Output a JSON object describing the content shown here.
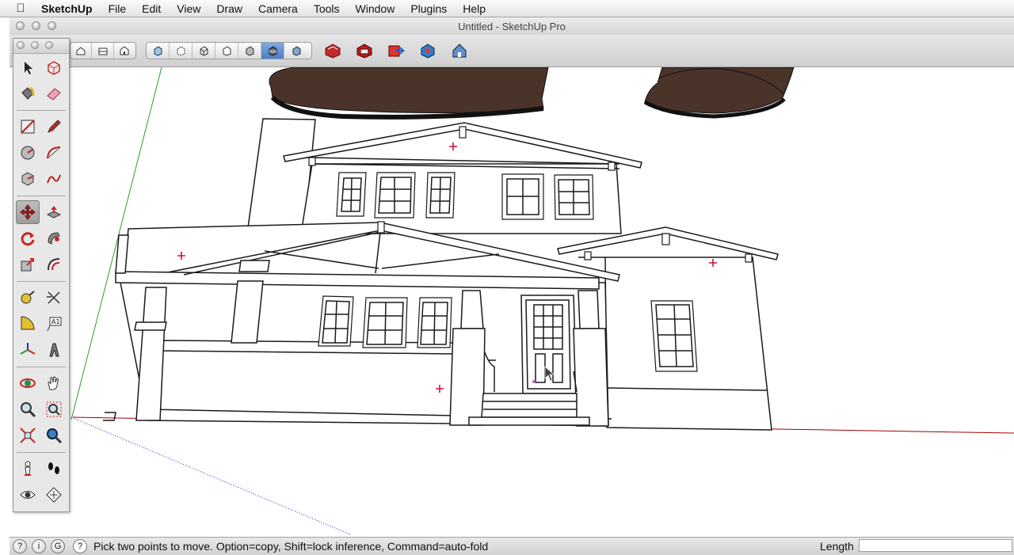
{
  "menubar": {
    "app_name": "SketchUp",
    "items": [
      "File",
      "Edit",
      "View",
      "Draw",
      "Camera",
      "Tools",
      "Window",
      "Plugins",
      "Help"
    ]
  },
  "window": {
    "title": "Untitled - SketchUp Pro"
  },
  "toolbar": {
    "view_buttons": [
      "iso-view",
      "top-view",
      "front-view",
      "right-view",
      "back-view",
      "left-view"
    ],
    "style_buttons": [
      "xray",
      "back-edges",
      "wireframe",
      "hidden-line",
      "shaded",
      "shaded-with-textures",
      "monochrome"
    ],
    "active_style": "shaded-with-textures",
    "warehouse_buttons": [
      "get-models",
      "share-model",
      "share-component",
      "extension-warehouse",
      "3d-warehouse"
    ]
  },
  "palette": {
    "tools": [
      "select",
      "make-component",
      "paint-bucket",
      "eraser",
      "rectangle",
      "line",
      "circle",
      "arc",
      "polygon",
      "freehand",
      "move",
      "push-pull",
      "rotate",
      "follow-me",
      "scale",
      "offset",
      "tape-measure",
      "dimension",
      "protractor",
      "text",
      "axes",
      "3d-text",
      "orbit",
      "pan",
      "zoom",
      "zoom-window",
      "zoom-extents",
      "previous",
      "position-camera",
      "walk",
      "look-around",
      "section-plane"
    ],
    "active_tool": "move"
  },
  "status": {
    "hint": "Pick two points to move.  Option=copy, Shift=lock inference, Command=auto-fold",
    "length_label": "Length",
    "length_value": ""
  },
  "colors": {
    "accent": "#4d7fc6",
    "axis_red": "#a00000",
    "axis_green": "#2e9e2e",
    "axis_blue": "#2030c0",
    "shoe_brown": "#4a3329",
    "guide_point": "#d0103a"
  }
}
